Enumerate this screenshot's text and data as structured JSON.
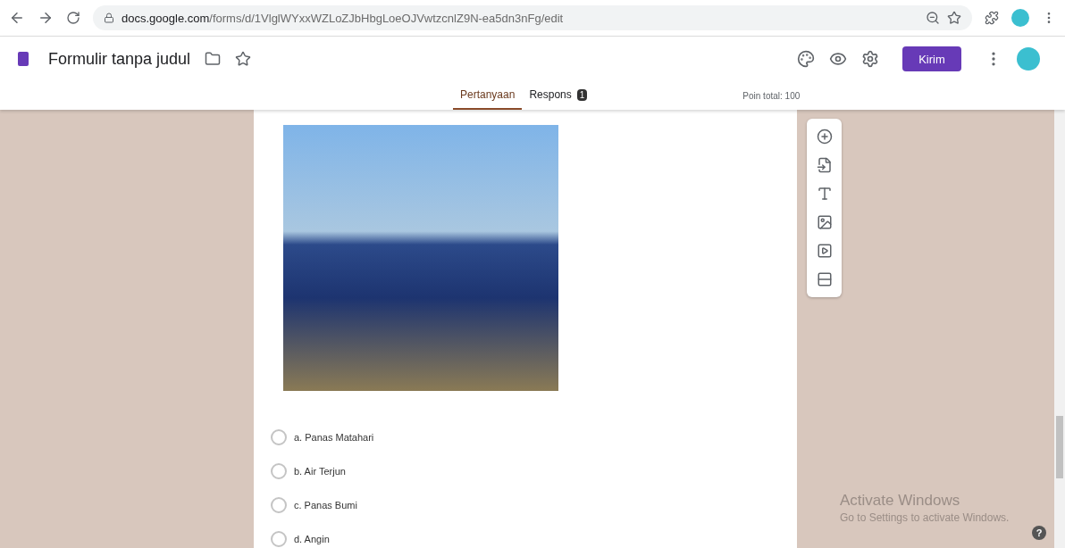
{
  "browser": {
    "url_host": "docs.google.com",
    "url_path": "/forms/d/1VlglWYxxWZLoZJbHbgLoeOJVwtzcnlZ9N-ea5dn3nFg/edit"
  },
  "header": {
    "title": "Formulir tanpa judul",
    "send_button": "Kirim"
  },
  "tabs": [
    {
      "label": "Pertanyaan",
      "selected": true
    },
    {
      "label": "Respons",
      "selected": false,
      "badge": "1"
    }
  ],
  "points_total": "Poin total: 100",
  "question": {
    "options": [
      {
        "label": "a. Panas Matahari",
        "selected": false
      },
      {
        "label": "b. Air Terjun",
        "selected": false
      },
      {
        "label": "c. Panas Bumi",
        "selected": false
      },
      {
        "label": "d. Angin",
        "selected": false
      }
    ]
  },
  "os_notice": {
    "title": "Activate Windows",
    "subtitle": "Go to Settings to activate Windows."
  },
  "help_button": "?"
}
